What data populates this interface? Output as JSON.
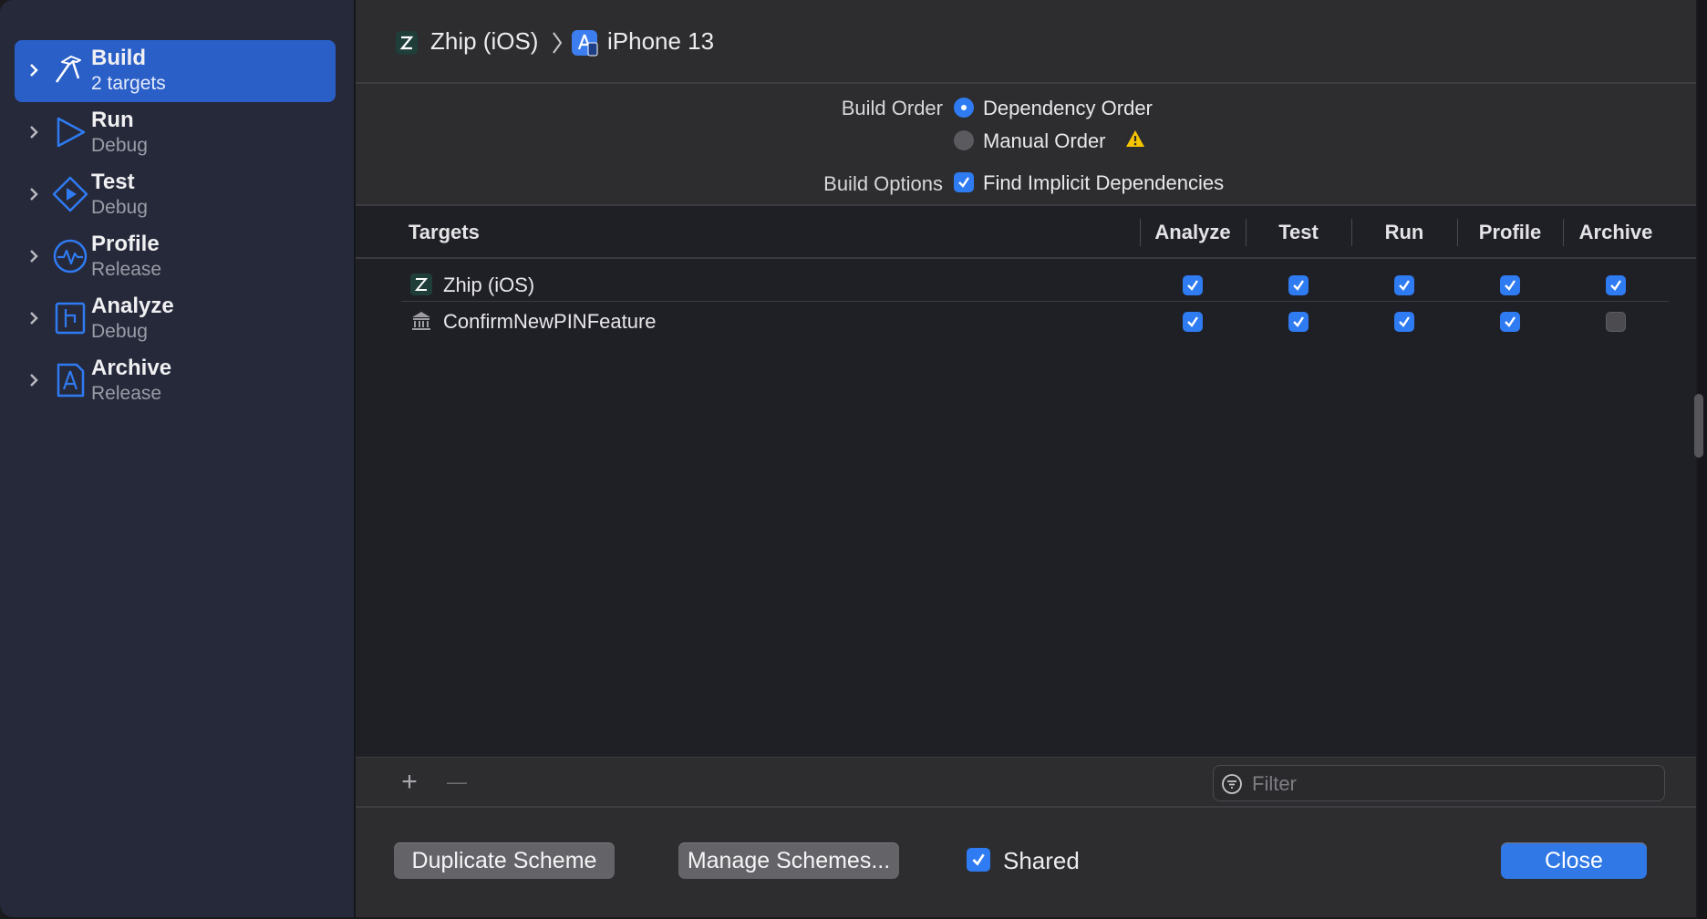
{
  "sidebar": {
    "items": [
      {
        "title": "Build",
        "subtitle": "2 targets",
        "icon": "hammer-icon",
        "selected": true
      },
      {
        "title": "Run",
        "subtitle": "Debug",
        "icon": "play-icon",
        "selected": false
      },
      {
        "title": "Test",
        "subtitle": "Debug",
        "icon": "test-diamond-icon",
        "selected": false
      },
      {
        "title": "Profile",
        "subtitle": "Release",
        "icon": "waveform-icon",
        "selected": false
      },
      {
        "title": "Analyze",
        "subtitle": "Debug",
        "icon": "analyze-icon",
        "selected": false
      },
      {
        "title": "Archive",
        "subtitle": "Release",
        "icon": "archive-icon",
        "selected": false
      }
    ]
  },
  "header": {
    "project": "Zhip (iOS)",
    "device": "iPhone 13"
  },
  "build": {
    "order_label": "Build Order",
    "order_options": [
      {
        "label": "Dependency Order",
        "selected": true
      },
      {
        "label": "Manual Order",
        "selected": false,
        "warning": true
      }
    ],
    "options_label": "Build Options",
    "find_implicit": {
      "label": "Find Implicit Dependencies",
      "checked": true
    }
  },
  "table": {
    "columns": [
      "Targets",
      "Analyze",
      "Test",
      "Run",
      "Profile",
      "Archive"
    ],
    "rows": [
      {
        "name": "Zhip (iOS)",
        "icon": "app-target-icon",
        "checks": [
          true,
          true,
          true,
          true,
          true
        ]
      },
      {
        "name": "ConfirmNewPINFeature",
        "icon": "framework-icon",
        "checks": [
          true,
          true,
          true,
          true,
          false
        ]
      }
    ]
  },
  "toolbar": {
    "add_symbol": "+",
    "remove_symbol": "—",
    "filter_placeholder": "Filter"
  },
  "footer": {
    "duplicate_label": "Duplicate Scheme",
    "manage_label": "Manage Schemes...",
    "shared_label": "Shared",
    "shared_checked": true,
    "close_label": "Close"
  },
  "colors": {
    "accent": "#2f7bf2",
    "sidebar_selected": "#2a5fc8",
    "warning": "#f5c400"
  }
}
